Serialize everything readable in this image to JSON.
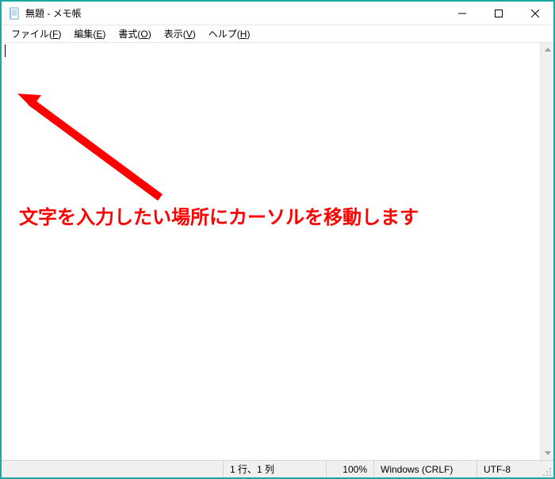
{
  "titlebar": {
    "title": "無題 - メモ帳"
  },
  "menubar": {
    "items": [
      {
        "label": "ファイル",
        "accel": "F"
      },
      {
        "label": "編集",
        "accel": "E"
      },
      {
        "label": "書式",
        "accel": "O"
      },
      {
        "label": "表示",
        "accel": "V"
      },
      {
        "label": "ヘルプ",
        "accel": "H"
      }
    ]
  },
  "textarea": {
    "content": ""
  },
  "statusbar": {
    "position": "1 行、1 列",
    "zoom": "100%",
    "eol": "Windows (CRLF)",
    "encoding": "UTF-8"
  },
  "annotation": {
    "text": "文字を入力したい場所にカーソルを移動します",
    "color": "#ff0000"
  }
}
